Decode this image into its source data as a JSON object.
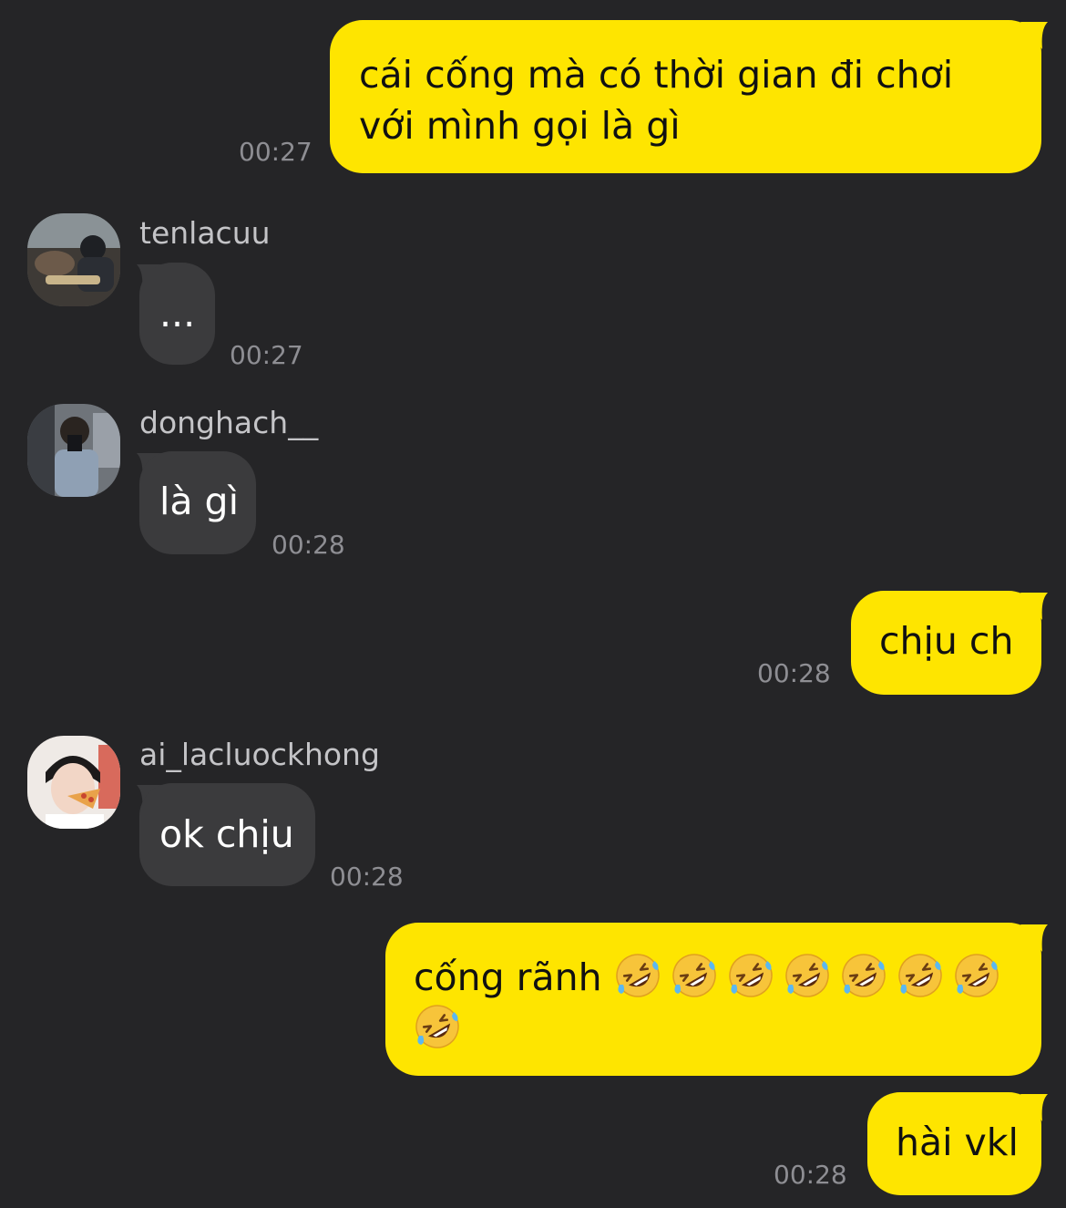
{
  "messages": [
    {
      "text": "cái cống mà có thời gian đi chơi với mình gọi là gì",
      "time": "00:27"
    },
    {
      "sender": "tenlacuu",
      "text": "...",
      "time": "00:27"
    },
    {
      "sender": "donghach__",
      "text": "là gì",
      "time": "00:28"
    },
    {
      "text": "chịu ch",
      "time": "00:28"
    },
    {
      "sender": "ai_lacluockhong",
      "text": "ok chịu",
      "time": "00:28"
    },
    {
      "text": "cống rãnh",
      "emoji": "rolling-on-floor-laughing",
      "emoji_count": 8
    },
    {
      "text": "hài vkl",
      "time": "00:28"
    }
  ],
  "colors": {
    "background": "#252527",
    "outgoing_bubble": "#FEE500",
    "incoming_bubble": "#3B3B3D",
    "timestamp": "#8E8E93"
  }
}
